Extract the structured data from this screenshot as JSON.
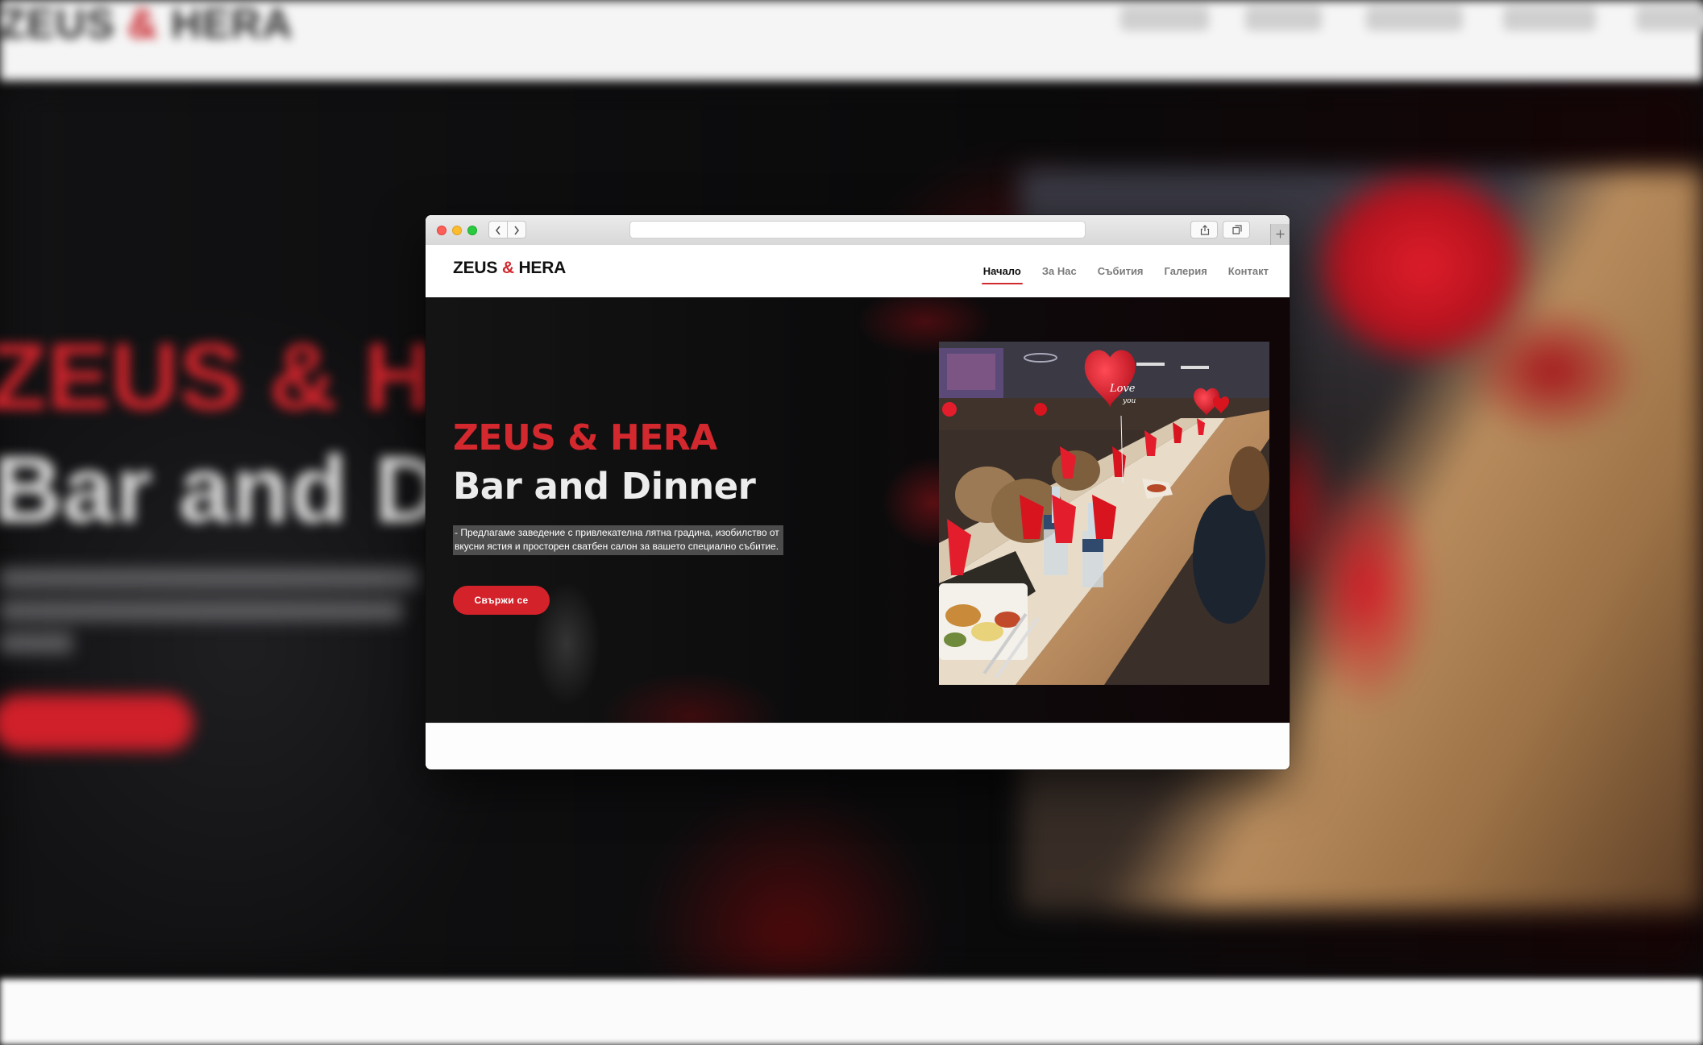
{
  "background": {
    "logo_left": "ZEUS",
    "logo_amp": "&",
    "logo_right": "HERA",
    "hero_title": "ZEUS & HERA",
    "hero_subtitle": "Bar and Dinner"
  },
  "browser": {
    "address_value": ""
  },
  "site": {
    "logo": {
      "left": "ZEUS ",
      "amp": "&",
      "right": " HERA"
    },
    "nav": [
      {
        "label": "Начало",
        "active": true
      },
      {
        "label": "За Нас",
        "active": false
      },
      {
        "label": "Събития",
        "active": false
      },
      {
        "label": "Галерия",
        "active": false
      },
      {
        "label": "Контакт",
        "active": false
      }
    ],
    "hero": {
      "title": "ZEUS & HERA",
      "subtitle": "Bar and Dinner",
      "description": "- Предлагаме заведение с привлекателна лятна градина, изобилство от вкусни ястия и просторен сватбен салон за вашето специално събитие.",
      "button_label": "Свържи се"
    }
  },
  "colors": {
    "accent": "#d12a2f",
    "hero_bg": "#0c0c0d",
    "header_bg": "#ffffff"
  },
  "icons": [
    "chevron-left-icon",
    "chevron-right-icon",
    "share-icon",
    "tabs-icon",
    "plus-icon"
  ]
}
